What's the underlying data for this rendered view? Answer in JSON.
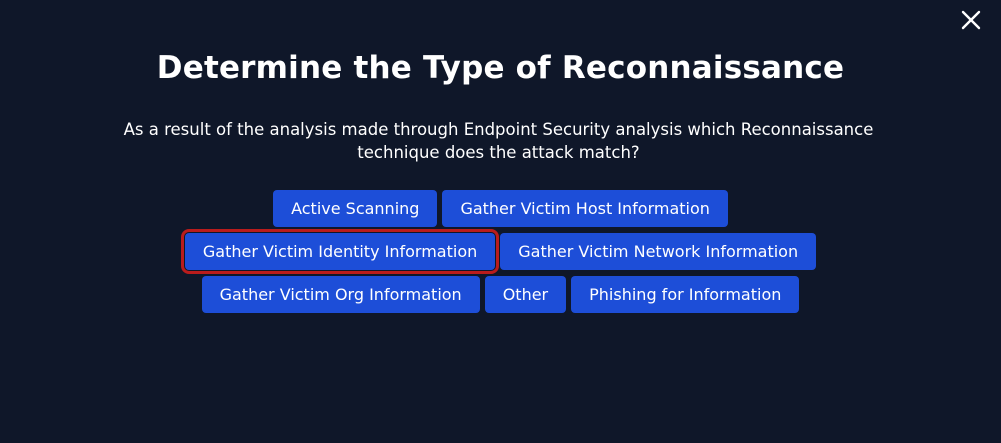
{
  "modal": {
    "title": "Determine the Type of Reconnaissance",
    "question": "As a result of the analysis made through Endpoint Security analysis which Reconnaissance technique does the attack match?",
    "close_icon": "close-icon"
  },
  "options": [
    {
      "label": "Active Scanning",
      "selected": false
    },
    {
      "label": "Gather Victim Host Information",
      "selected": false
    },
    {
      "label": "Gather Victim Identity Information",
      "selected": true
    },
    {
      "label": "Gather Victim Network Information",
      "selected": false
    },
    {
      "label": "Gather Victim Org Information",
      "selected": false
    },
    {
      "label": "Other",
      "selected": false
    },
    {
      "label": "Phishing for Information",
      "selected": false
    }
  ],
  "colors": {
    "background": "#0f1729",
    "button": "#1d4ed8",
    "selected_outline": "#b91c1c",
    "text": "#ffffff"
  }
}
